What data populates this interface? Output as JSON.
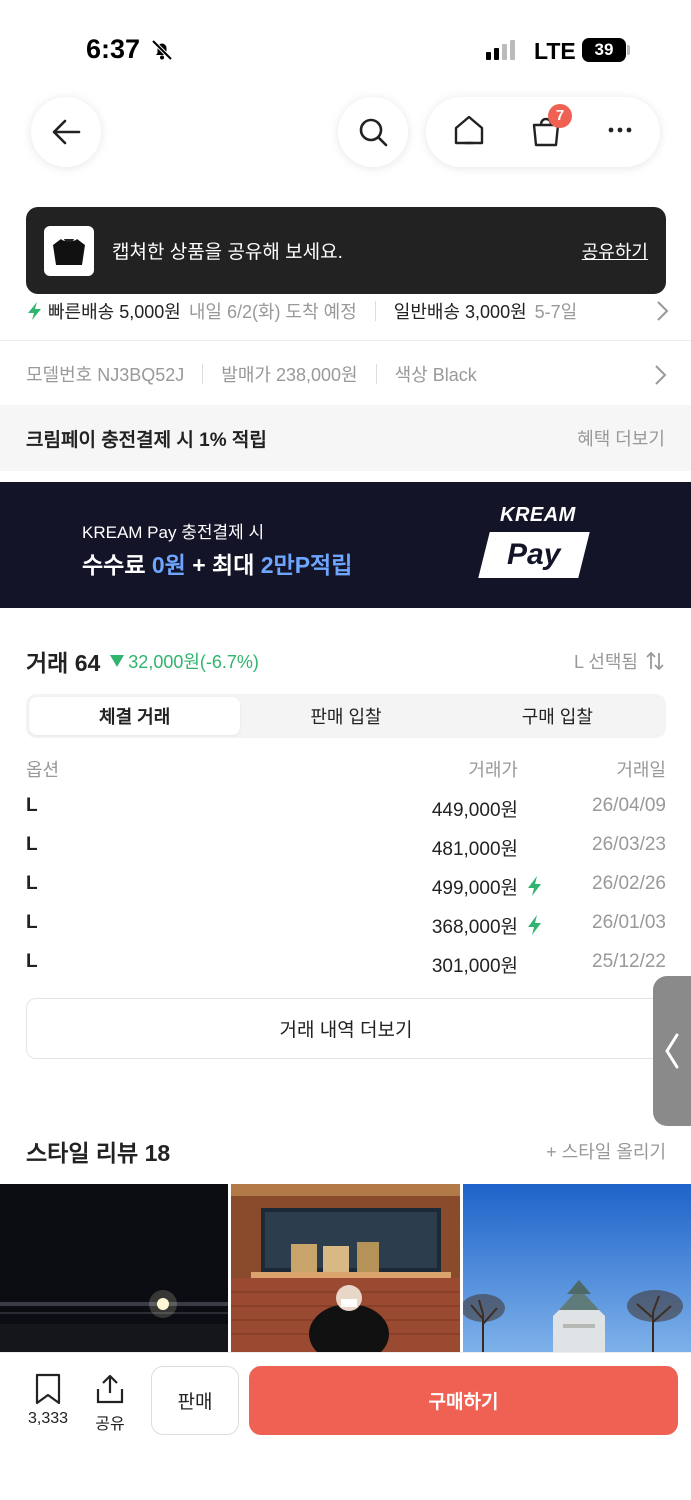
{
  "status_bar": {
    "time": "6:37",
    "network": "LTE",
    "battery": "39"
  },
  "nav": {
    "cart_count": "7"
  },
  "toast": {
    "message": "캡쳐한 상품을 공유해 보세요.",
    "action": "공유하기"
  },
  "shipping": {
    "fast_label": "빠른배송 5,000원",
    "fast_eta": "내일 6/2(화) 도착 예정",
    "normal_label": "일반배송 3,000원",
    "normal_eta": "5-7일"
  },
  "product_info": {
    "model": "모델번호 NJ3BQ52J",
    "release_price": "발매가 238,000원",
    "color": "색상 Black"
  },
  "benefit": {
    "title": "크림페이 충전결제 시 1% 적립",
    "link": "혜택 더보기"
  },
  "banner": {
    "line1": "KREAM Pay 충전결제 시",
    "line2_a": "수수료 ",
    "line2_b": "0원",
    "line2_c": " + 최대 ",
    "line2_d": "2만P적립",
    "logo_top": "KREAM",
    "logo_bottom": "Pay"
  },
  "trades": {
    "title": "거래 64",
    "change": "32,000원(-6.7%)",
    "selected": "L 선택됨",
    "tabs": [
      "체결 거래",
      "판매 입찰",
      "구매 입찰"
    ],
    "headers": {
      "option": "옵션",
      "price": "거래가",
      "date": "거래일"
    },
    "rows": [
      {
        "option": "L",
        "price": "449,000원",
        "date": "26/04/09",
        "fast": false
      },
      {
        "option": "L",
        "price": "481,000원",
        "date": "26/03/23",
        "fast": false
      },
      {
        "option": "L",
        "price": "499,000원",
        "date": "26/02/26",
        "fast": true
      },
      {
        "option": "L",
        "price": "368,000원",
        "date": "26/01/03",
        "fast": true
      },
      {
        "option": "L",
        "price": "301,000원",
        "date": "25/12/22",
        "fast": false
      }
    ],
    "more": "거래 내역 더보기"
  },
  "reviews": {
    "title": "스타일 리뷰 18",
    "link": "+ 스타일 올리기"
  },
  "bottom": {
    "save_count": "3,333",
    "share": "공유",
    "sell": "판매",
    "buy": "구매하기"
  },
  "colors": {
    "accent": "#ef6253",
    "green": "#31b46e",
    "banner_bg": "#131427",
    "banner_highlight": "#6ea6ff"
  }
}
